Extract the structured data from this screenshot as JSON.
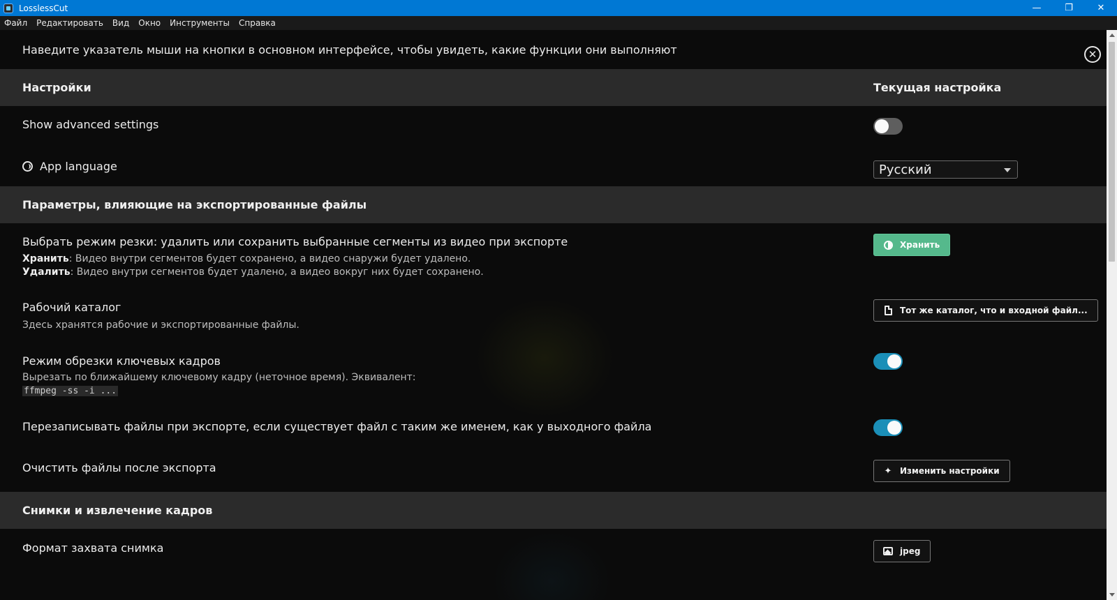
{
  "window": {
    "title": "LosslessCut",
    "controls": {
      "minimize": "—",
      "maximize": "❐",
      "close": "✕"
    }
  },
  "menu": [
    "Файл",
    "Редактировать",
    "Вид",
    "Окно",
    "Инструменты",
    "Справка"
  ],
  "hint": "Наведите указатель мыши на кнопки в основном интерфейсе, чтобы увидеть, какие функции они выполняют",
  "close_icon": "✕",
  "sections": {
    "settings": {
      "title": "Настройки",
      "current_setting": "Текущая настройка"
    },
    "export_params": {
      "title": "Параметры, влияющие на экспортированные файлы"
    },
    "snapshots": {
      "title": "Снимки и извлечение кадров"
    }
  },
  "rows": {
    "advanced": {
      "title": "Show advanced settings",
      "enabled": false
    },
    "language": {
      "title": "App language",
      "icon": "globe-icon",
      "value": "Русский"
    },
    "cut_mode": {
      "title": "Выбрать режим резки: удалить или сохранить выбранные сегменты из видео при экспорте",
      "keep_label": "Хранить",
      "keep_desc": ": Видео внутри сегментов будет сохранено, а видео снаружи будет удалено.",
      "remove_label": "Удалить",
      "remove_desc": ": Видео внутри сегментов будет удалено, а видео вокруг них будет сохранено.",
      "button": "Хранить",
      "button_icon": "yin-yang-icon"
    },
    "working_dir": {
      "title": "Рабочий каталог",
      "desc": "Здесь хранятся рабочие и экспортированные файлы.",
      "button": "Тот же каталог, что и входной файл...",
      "button_icon": "file-icon"
    },
    "keyframe": {
      "title": "Режим обрезки ключевых кадров",
      "desc": "Вырезать по ближайшему ключевому кадру (неточное время). Эквивалент:",
      "code": "ffmpeg -ss -i ...",
      "enabled": true
    },
    "overwrite": {
      "title": "Перезаписывать файлы при экспорте, если существует файл с таким же именем, как у выходного файла",
      "enabled": true
    },
    "cleanup": {
      "title": "Очистить файлы после экспорта",
      "button": "Изменить настройки",
      "button_icon": "sparkle-icon"
    },
    "snapshot_format": {
      "title": "Формат захвата снимка",
      "button": "jpeg",
      "button_icon": "image-icon"
    }
  },
  "colors": {
    "titlebar": "#0078d4",
    "section_header": "#2b2b2b",
    "toggle_on": "#1b8fb8",
    "toggle_off": "#5e5e5e",
    "keep_button": "#55b98c"
  }
}
